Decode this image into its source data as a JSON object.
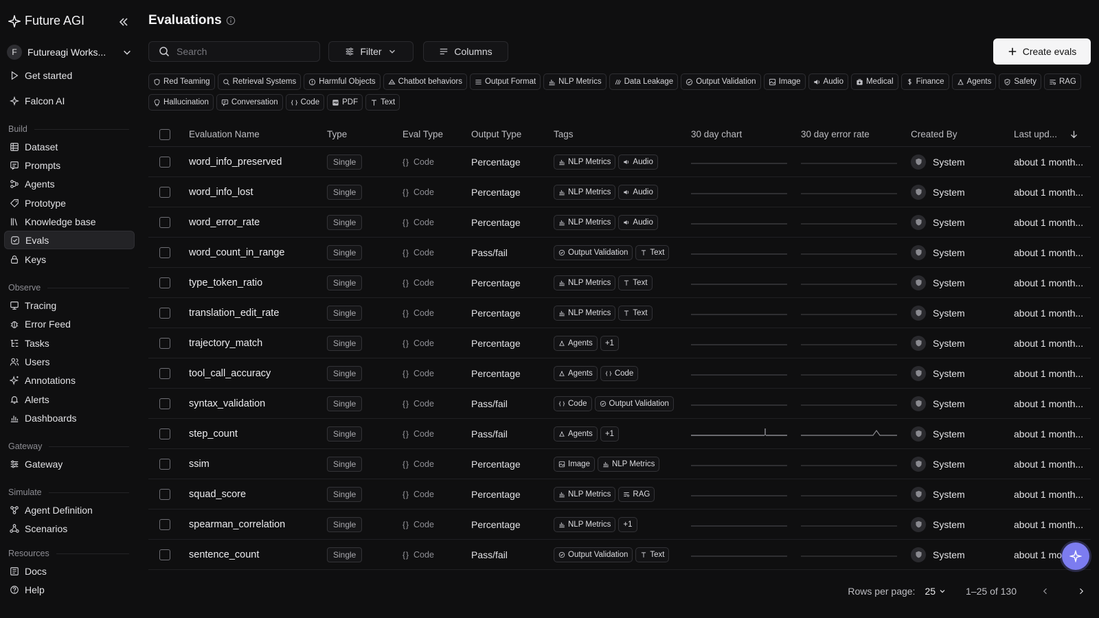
{
  "brand": {
    "name": "Future AGI"
  },
  "workspace": {
    "initial": "F",
    "name": "Futureagi Works..."
  },
  "nav_top": [
    {
      "label": "Get started",
      "icon": "play-icon"
    },
    {
      "label": "Falcon AI",
      "icon": "falcon-icon"
    }
  ],
  "sections": {
    "build": "Build",
    "observe": "Observe",
    "gateway": "Gateway",
    "simulate": "Simulate",
    "resources": "Resources"
  },
  "nav_build": [
    {
      "label": "Dataset"
    },
    {
      "label": "Prompts"
    },
    {
      "label": "Agents"
    },
    {
      "label": "Prototype"
    },
    {
      "label": "Knowledge base"
    },
    {
      "label": "Evals"
    },
    {
      "label": "Keys"
    }
  ],
  "nav_observe": [
    {
      "label": "Tracing"
    },
    {
      "label": "Error Feed"
    },
    {
      "label": "Tasks"
    },
    {
      "label": "Users"
    },
    {
      "label": "Annotations"
    },
    {
      "label": "Alerts"
    },
    {
      "label": "Dashboards"
    }
  ],
  "nav_gateway": [
    {
      "label": "Gateway"
    }
  ],
  "nav_simulate": [
    {
      "label": "Agent Definition"
    },
    {
      "label": "Scenarios"
    }
  ],
  "nav_resources": [
    {
      "label": "Docs"
    },
    {
      "label": "Help"
    }
  ],
  "page": {
    "title": "Evaluations"
  },
  "toolbar": {
    "search_placeholder": "Search",
    "filter_label": "Filter",
    "columns_label": "Columns",
    "create_label": "Create evals"
  },
  "categories": [
    "Red Teaming",
    "Retrieval Systems",
    "Harmful Objects",
    "Chatbot behaviors",
    "Output Format",
    "NLP Metrics",
    "Data Leakage",
    "Output Validation",
    "Image",
    "Audio",
    "Medical",
    "Finance",
    "Agents",
    "Safety",
    "RAG",
    "Hallucination",
    "Conversation",
    "Code",
    "PDF",
    "Text"
  ],
  "table": {
    "columns": {
      "name": "Evaluation Name",
      "type": "Type",
      "eval_type": "Eval Type",
      "output_type": "Output Type",
      "tags": "Tags",
      "chart": "30 day chart",
      "error_rate": "30 day error rate",
      "created_by": "Created By",
      "last_updated": "Last upd..."
    },
    "rows": [
      {
        "name": "word_info_preserved",
        "type": "Single",
        "eval_type": "Code",
        "output": "Percentage",
        "tags": [
          "NLP Metrics",
          "Audio"
        ],
        "created_by": "System",
        "updated": "about 1 month..."
      },
      {
        "name": "word_info_lost",
        "type": "Single",
        "eval_type": "Code",
        "output": "Percentage",
        "tags": [
          "NLP Metrics",
          "Audio"
        ],
        "created_by": "System",
        "updated": "about 1 month..."
      },
      {
        "name": "word_error_rate",
        "type": "Single",
        "eval_type": "Code",
        "output": "Percentage",
        "tags": [
          "NLP Metrics",
          "Audio"
        ],
        "created_by": "System",
        "updated": "about 1 month..."
      },
      {
        "name": "word_count_in_range",
        "type": "Single",
        "eval_type": "Code",
        "output": "Pass/fail",
        "tags": [
          "Output Validation",
          "Text"
        ],
        "created_by": "System",
        "updated": "about 1 month..."
      },
      {
        "name": "type_token_ratio",
        "type": "Single",
        "eval_type": "Code",
        "output": "Percentage",
        "tags": [
          "NLP Metrics",
          "Text"
        ],
        "created_by": "System",
        "updated": "about 1 month..."
      },
      {
        "name": "translation_edit_rate",
        "type": "Single",
        "eval_type": "Code",
        "output": "Percentage",
        "tags": [
          "NLP Metrics",
          "Text"
        ],
        "created_by": "System",
        "updated": "about 1 month..."
      },
      {
        "name": "trajectory_match",
        "type": "Single",
        "eval_type": "Code",
        "output": "Percentage",
        "tags": [
          "Agents",
          "+1"
        ],
        "created_by": "System",
        "updated": "about 1 month..."
      },
      {
        "name": "tool_call_accuracy",
        "type": "Single",
        "eval_type": "Code",
        "output": "Percentage",
        "tags": [
          "Agents",
          "Code"
        ],
        "created_by": "System",
        "updated": "about 1 month..."
      },
      {
        "name": "syntax_validation",
        "type": "Single",
        "eval_type": "Code",
        "output": "Pass/fail",
        "tags": [
          "Code",
          "Output Validation"
        ],
        "created_by": "System",
        "updated": "about 1 month..."
      },
      {
        "name": "step_count",
        "type": "Single",
        "eval_type": "Code",
        "output": "Pass/fail",
        "tags": [
          "Agents",
          "+1"
        ],
        "created_by": "System",
        "updated": "about 1 month...",
        "spike": true
      },
      {
        "name": "ssim",
        "type": "Single",
        "eval_type": "Code",
        "output": "Percentage",
        "tags": [
          "Image",
          "NLP Metrics"
        ],
        "created_by": "System",
        "updated": "about 1 month..."
      },
      {
        "name": "squad_score",
        "type": "Single",
        "eval_type": "Code",
        "output": "Percentage",
        "tags": [
          "NLP Metrics",
          "RAG"
        ],
        "created_by": "System",
        "updated": "about 1 month..."
      },
      {
        "name": "spearman_correlation",
        "type": "Single",
        "eval_type": "Code",
        "output": "Percentage",
        "tags": [
          "NLP Metrics",
          "+1"
        ],
        "created_by": "System",
        "updated": "about 1 month..."
      },
      {
        "name": "sentence_count",
        "type": "Single",
        "eval_type": "Code",
        "output": "Pass/fail",
        "tags": [
          "Output Validation",
          "Text"
        ],
        "created_by": "System",
        "updated": "about 1 mon..."
      }
    ]
  },
  "pagination": {
    "rows_label": "Rows per page:",
    "rows_value": "25",
    "range": "1–25 of 130"
  },
  "colors": {
    "accent": "#7c7cf0",
    "background": "#0f0f10"
  }
}
